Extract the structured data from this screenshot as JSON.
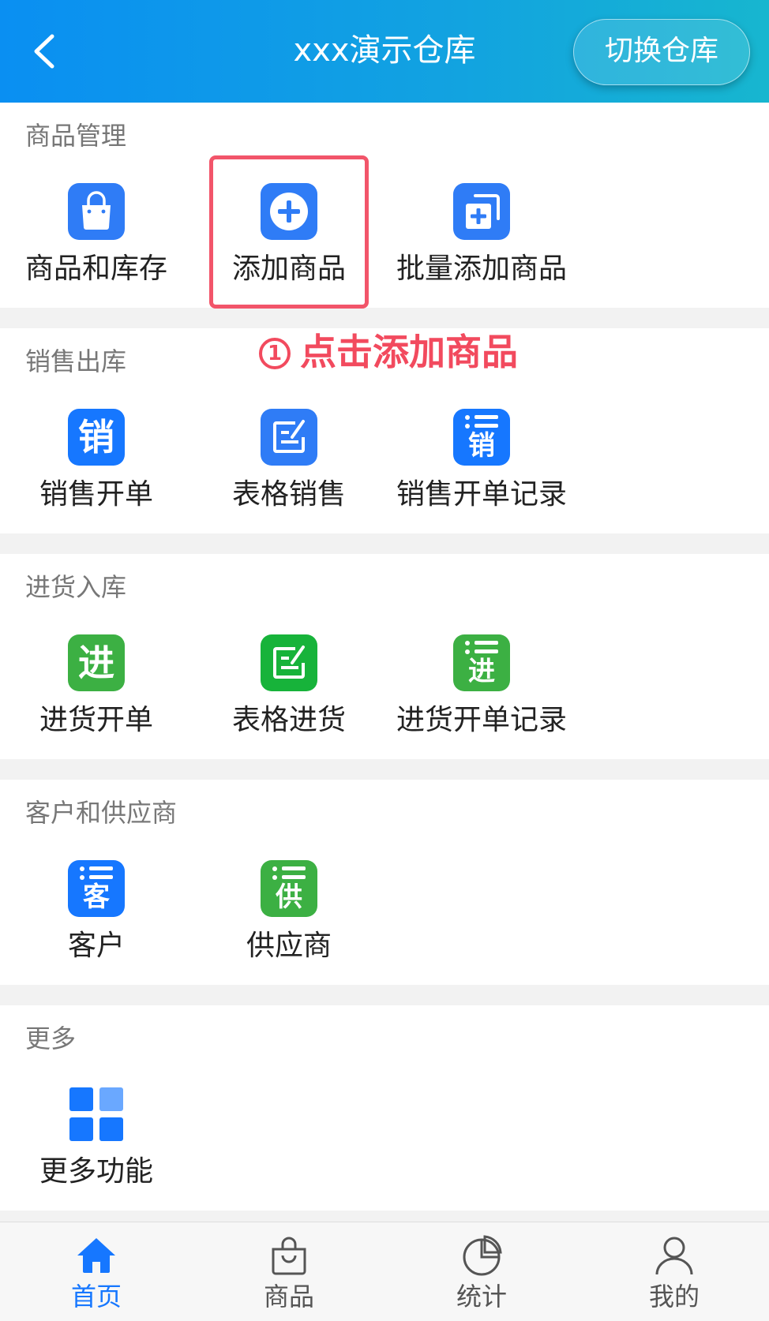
{
  "header": {
    "title": "xxx演示仓库",
    "switch_label": "切换仓库"
  },
  "sections": {
    "goods": {
      "title": "商品管理",
      "items": [
        "商品和库存",
        "添加商品",
        "批量添加商品"
      ]
    },
    "sales": {
      "title": "销售出库",
      "items": [
        "销售开单",
        "表格销售",
        "销售开单记录"
      ],
      "glyphs": [
        "销",
        "销"
      ]
    },
    "purchase": {
      "title": "进货入库",
      "items": [
        "进货开单",
        "表格进货",
        "进货开单记录"
      ],
      "glyphs": [
        "进",
        "进"
      ]
    },
    "partners": {
      "title": "客户和供应商",
      "items": [
        "客户",
        "供应商"
      ],
      "glyphs": [
        "客",
        "供"
      ]
    },
    "more": {
      "title": "更多",
      "items": [
        "更多功能"
      ]
    }
  },
  "annotation": {
    "number": "1",
    "text": "点击添加商品"
  },
  "tabbar": {
    "items": [
      "首页",
      "商品",
      "统计",
      "我的"
    ],
    "active": "首页"
  },
  "colors": {
    "header_start": "#0a8ff2",
    "header_end": "#17b6cf",
    "accent_blue": "#1677ff",
    "accent_green": "#3cb043",
    "highlight_red": "#f2556a"
  }
}
